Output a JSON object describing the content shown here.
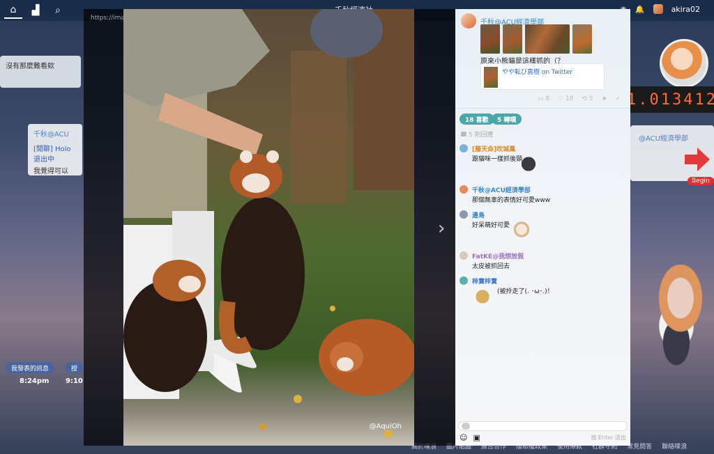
{
  "topbar": {
    "title": "千秋經濟社",
    "home_icon": "home-icon",
    "stats_icon": "bar-chart-icon",
    "search_icon": "search-icon",
    "username": "akira02"
  },
  "background": {
    "left_text": "沒有那麼難看欸",
    "left_card_name": "千秋@ACU",
    "left_card_link": "[閒聊] Holo 退出中",
    "left_card_text": "我覺得可以",
    "my_posts_button": "我發表的訊息",
    "other_button": "授",
    "time_1": "8:24pm",
    "time_2": "9:10",
    "counter": "1.013412",
    "right_card_name": "@ACU經濟學部",
    "begin_label": "Begin",
    "footer": [
      "關於噗浪",
      "圖片貼圖",
      "廣告合作",
      "隱私權政策",
      "使用條款",
      "社群守則",
      "常見問答",
      "聯絡噗浪"
    ]
  },
  "viewer": {
    "image_url": "https://images.plurk.com/51c0ZubKs0TupwK3Ue8kyw.png",
    "watermark": "@AquiOh"
  },
  "panel": {
    "post_user": "千秋@ACU經濟學部",
    "post_text": "原來小熊貓是這樣抓的（？",
    "link_text": "やや転び直樹 on Twitter",
    "actions": {
      "responses": "8",
      "likes": "18",
      "replurks": "5"
    },
    "likes_pill": "18 喜歡",
    "replurks_pill": "5 轉噗",
    "response_count": "5 則回應",
    "comments": [
      {
        "name": "[藤天命]吹城鳳",
        "text": "跟貓咪一樣抓後頸",
        "color": "#d98a2a"
      },
      {
        "name": "千秋@ACU經濟學部",
        "text": "那個無辜的表情好可愛www",
        "color": "#3f86c9"
      },
      {
        "name": "邊島",
        "text": "好呆萌好可愛",
        "color": "#3f86c9"
      },
      {
        "name": "FatKE@我想放假",
        "text": "太皮被抓回去",
        "color": "#a070c0"
      },
      {
        "name": "梓寶梓寶",
        "text": "(被拎走了(. ･ω･.)！",
        "color": "#3a78d0"
      }
    ],
    "reply_hint": "按 Enter 送出"
  }
}
